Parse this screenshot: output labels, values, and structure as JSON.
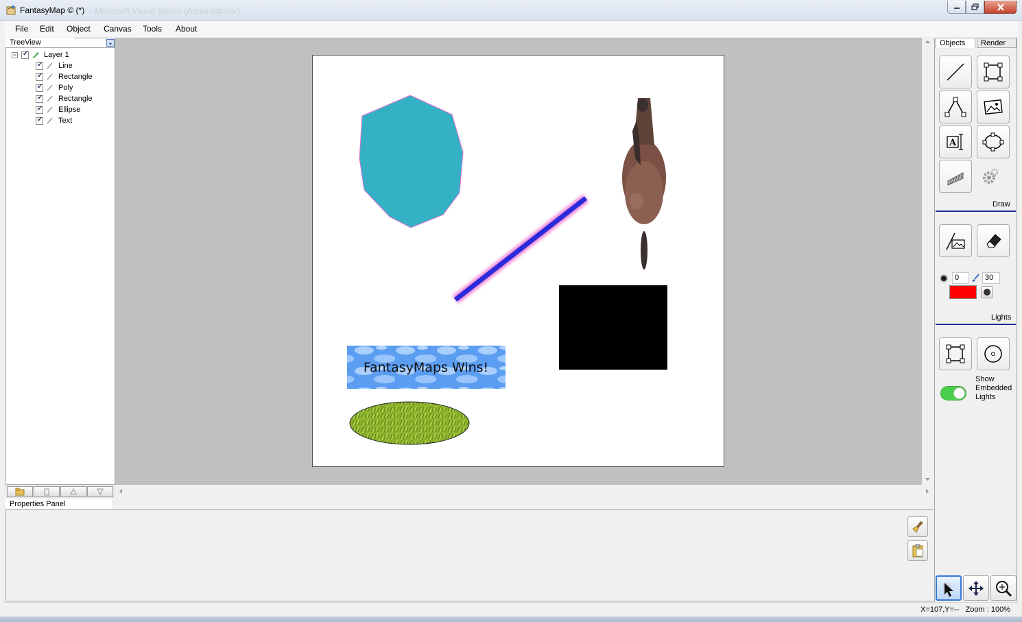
{
  "window": {
    "title": "FantasyMap © (*)",
    "ghost_title": "– Microsoft Visual Studio (Administrator)"
  },
  "menu": [
    "File",
    "Edit",
    "Object",
    "Canvas",
    "Tools",
    "About"
  ],
  "treeview": {
    "tab_label": "TreeView",
    "layer": {
      "label": "Layer 1",
      "checked": true
    },
    "items": [
      {
        "label": "Line",
        "checked": true
      },
      {
        "label": "Rectangle",
        "checked": true
      },
      {
        "label": "Poly",
        "checked": true
      },
      {
        "label": "Rectangle",
        "checked": true
      },
      {
        "label": "Ellipse",
        "checked": true
      },
      {
        "label": "Text",
        "checked": true
      }
    ]
  },
  "canvas": {
    "text_object": "FantasyMaps Wins!",
    "colors": {
      "poly_fill": "#35b1c5",
      "line_stroke": "#2b2bd9",
      "line_glow": "#f07ad6",
      "rect_fill": "#000000",
      "paper": "#ffffff",
      "workspace": "#c0c0c0"
    }
  },
  "properties_panel": {
    "tab_label": "Properties Panel"
  },
  "right_panel": {
    "tabs": [
      "Objects",
      "Render"
    ],
    "active_tab": "Objects",
    "draw_label": "Draw",
    "lights_label": "Lights",
    "brush_size": "0",
    "brush_opacity": "30",
    "brush_color": "#ff0000",
    "show_embedded_lights": {
      "line1": "Show",
      "line2": "Embedded",
      "line3": "Lights",
      "enabled": true
    }
  },
  "status": {
    "text": "X=107,Y=--   Zoom : 100%"
  }
}
